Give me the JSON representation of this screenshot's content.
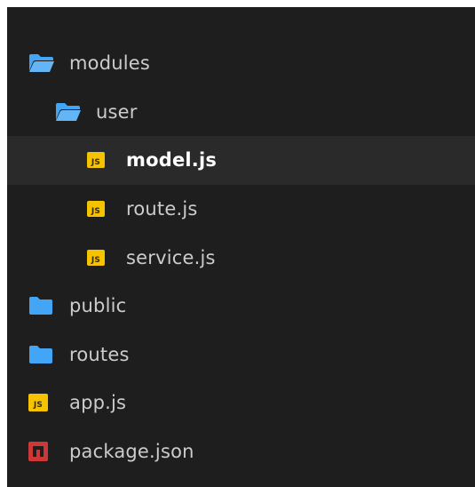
{
  "explorer": {
    "items": [
      {
        "label": "modules",
        "icon": "folder-open-icon",
        "depth": 0,
        "selected": false
      },
      {
        "label": "user",
        "icon": "folder-open-icon",
        "depth": 1,
        "selected": false
      },
      {
        "label": "model.js",
        "icon": "js-file-icon",
        "depth": 2,
        "selected": true
      },
      {
        "label": "route.js",
        "icon": "js-file-icon",
        "depth": 2,
        "selected": false
      },
      {
        "label": "service.js",
        "icon": "js-file-icon",
        "depth": 2,
        "selected": false
      },
      {
        "label": "public",
        "icon": "folder-icon",
        "depth": 0,
        "selected": false
      },
      {
        "label": "routes",
        "icon": "folder-icon",
        "depth": 0,
        "selected": false
      },
      {
        "label": "app.js",
        "icon": "js-file-icon",
        "depth": 0,
        "selected": false
      },
      {
        "label": "package.json",
        "icon": "npm-icon",
        "depth": 0,
        "selected": false
      }
    ],
    "colors": {
      "background": "#1e1e1e",
      "selected_row": "#2a2a2a",
      "text": "#cccccc",
      "selected_text": "#ffffff",
      "folder": "#42a5f5",
      "js_badge": "#f5c300",
      "npm_badge": "#cb3837"
    }
  }
}
